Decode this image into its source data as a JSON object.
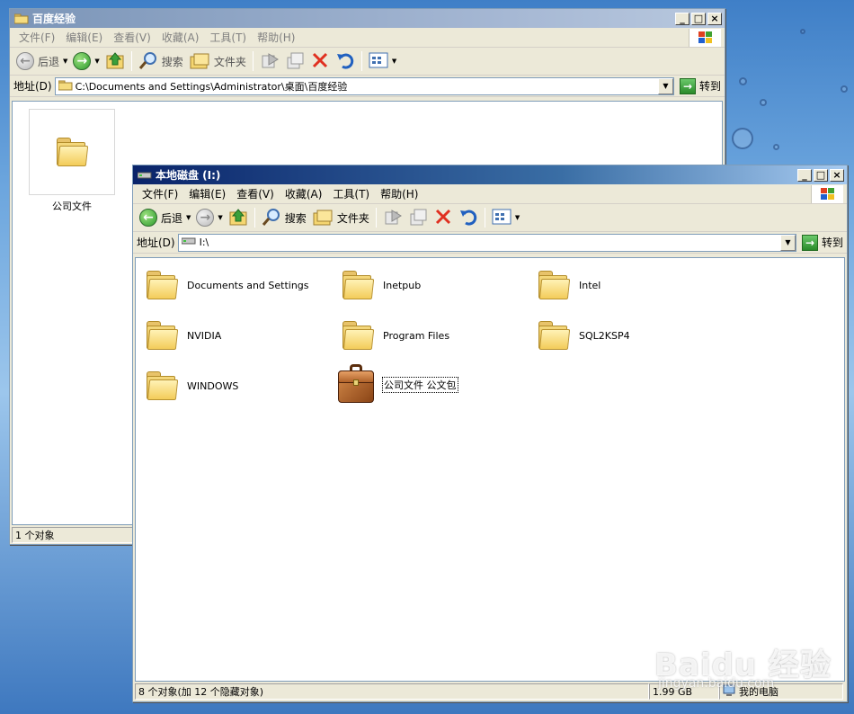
{
  "back_window": {
    "title": "百度经验",
    "menu": [
      "文件(F)",
      "编辑(E)",
      "查看(V)",
      "收藏(A)",
      "工具(T)",
      "帮助(H)"
    ],
    "toolbar": {
      "back": "后退",
      "search": "搜索",
      "folders": "文件夹"
    },
    "address_label": "地址(D)",
    "address_value": "C:\\Documents and Settings\\Administrator\\桌面\\百度经验",
    "go_label": "转到",
    "items": [
      {
        "name": "公司文件",
        "icon": "folder-icon"
      }
    ],
    "status": "1 个对象"
  },
  "front_window": {
    "title": "本地磁盘 (I:)",
    "menu": [
      "文件(F)",
      "编辑(E)",
      "查看(V)",
      "收藏(A)",
      "工具(T)",
      "帮助(H)"
    ],
    "toolbar": {
      "back": "后退",
      "search": "搜索",
      "folders": "文件夹"
    },
    "address_label": "地址(D)",
    "address_value": "I:\\",
    "go_label": "转到",
    "items": [
      {
        "name": "Documents and Settings",
        "icon": "folder-icon"
      },
      {
        "name": "Inetpub",
        "icon": "folder-icon"
      },
      {
        "name": "Intel",
        "icon": "folder-icon"
      },
      {
        "name": "NVIDIA",
        "icon": "folder-icon"
      },
      {
        "name": "Program Files",
        "icon": "folder-icon"
      },
      {
        "name": "SQL2KSP4",
        "icon": "folder-icon"
      },
      {
        "name": "WINDOWS",
        "icon": "folder-icon"
      },
      {
        "name": "公司文件 公文包",
        "icon": "briefcase-icon"
      }
    ],
    "status": {
      "objects": "8 个对象(加 12 个隐藏对象)",
      "size": "1.99 GB",
      "location": "我的电脑"
    }
  },
  "watermark": {
    "brand": "Baidu 经验",
    "url": "jingyan.baidu.com"
  }
}
